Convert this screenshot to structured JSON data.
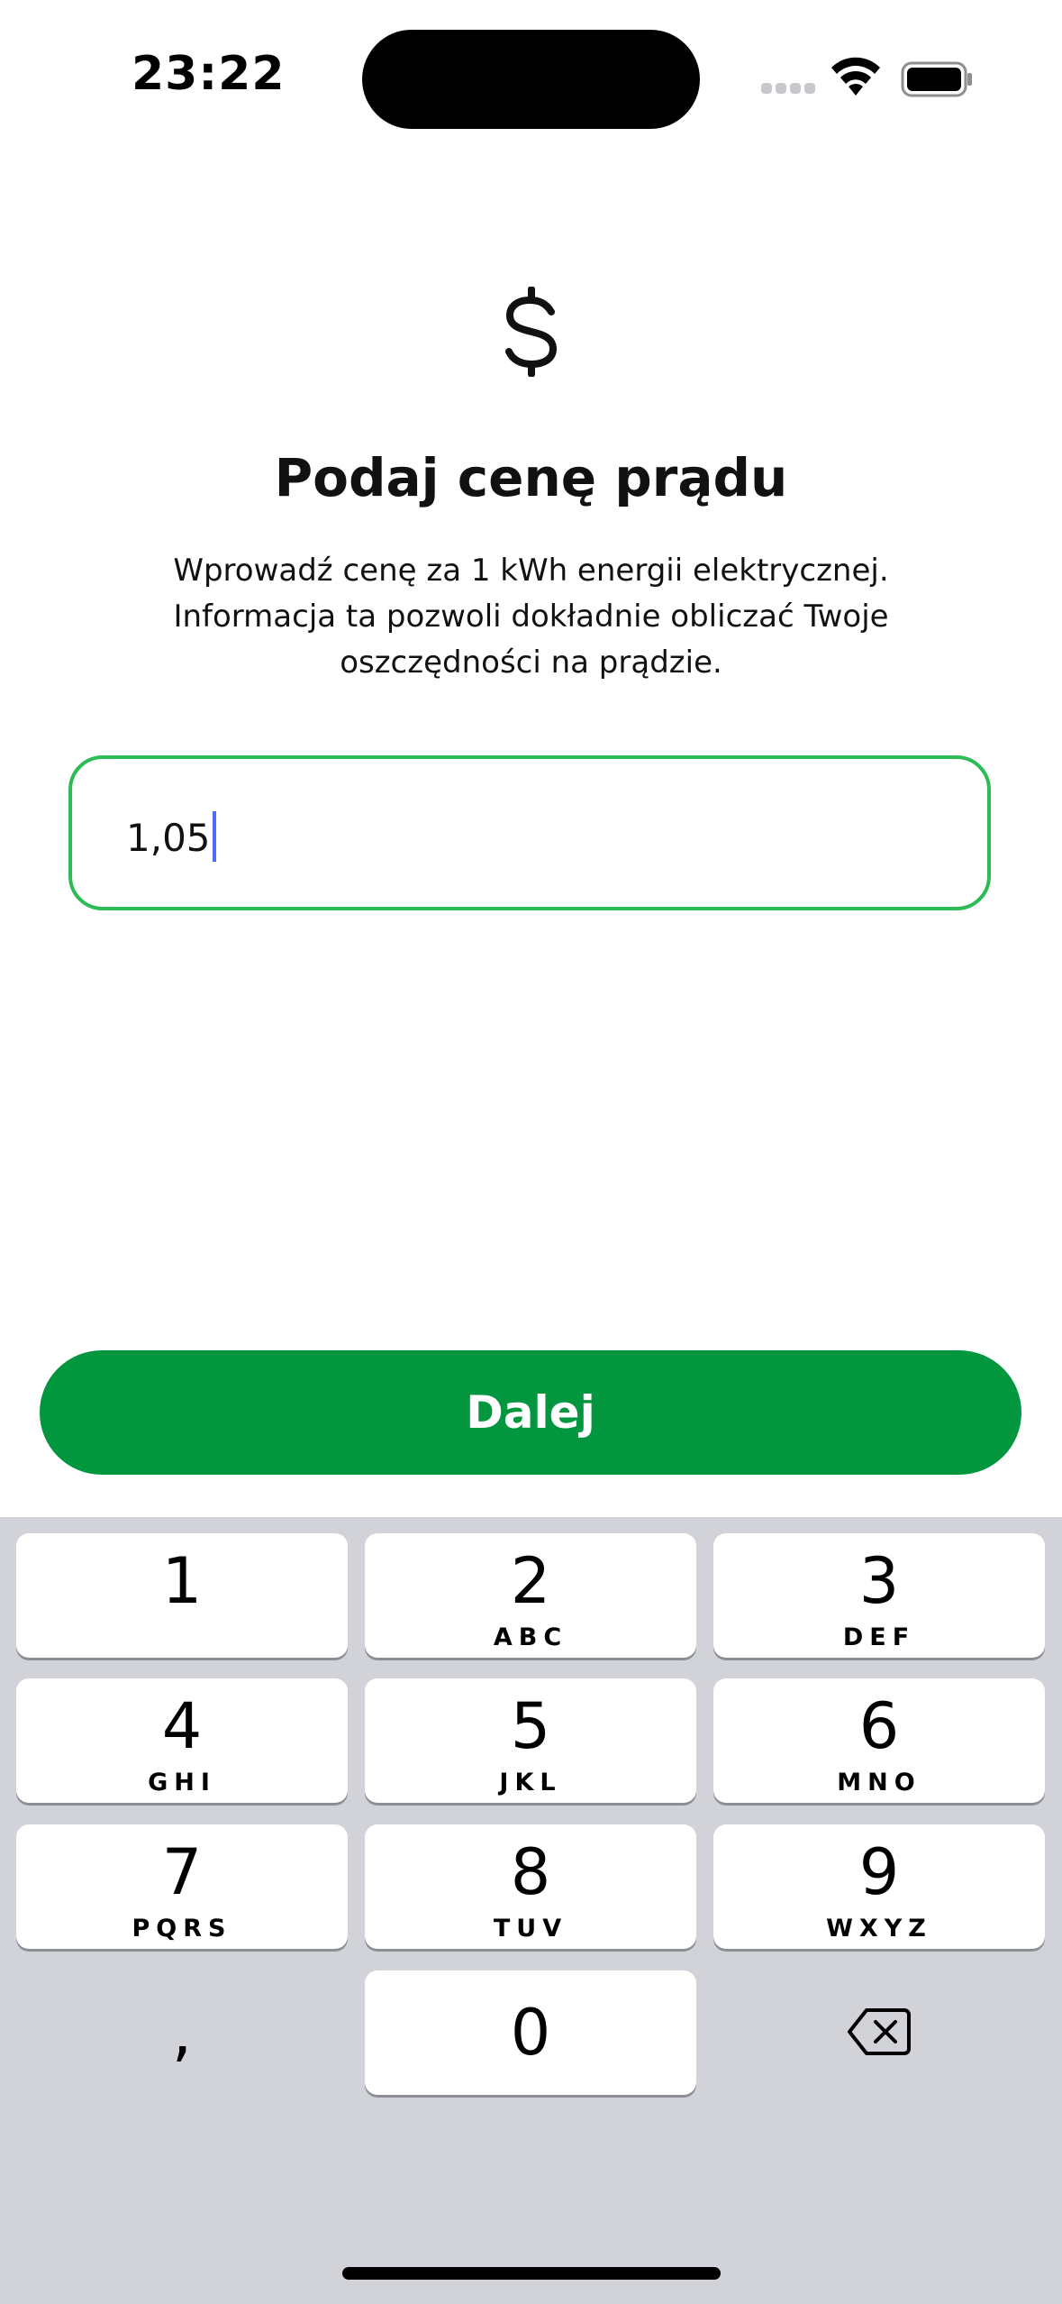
{
  "status_bar": {
    "time": "23:22"
  },
  "screen": {
    "icon": "dollar-icon",
    "title": "Podaj cenę prądu",
    "description_lines": [
      "Wprowadź cenę za 1 kWh energii elektrycznej.",
      "Informacja ta pozwoli dokładnie obliczać Twoje",
      "oszczędności na prądzie."
    ],
    "price_input": {
      "value": "1,05"
    },
    "next_button": {
      "label": "Dalej"
    }
  },
  "keyboard": {
    "keys": [
      {
        "number": "1",
        "letters": ""
      },
      {
        "number": "2",
        "letters": "ABC"
      },
      {
        "number": "3",
        "letters": "DEF"
      },
      {
        "number": "4",
        "letters": "GHI"
      },
      {
        "number": "5",
        "letters": "JKL"
      },
      {
        "number": "6",
        "letters": "MNO"
      },
      {
        "number": "7",
        "letters": "PQRS"
      },
      {
        "number": "8",
        "letters": "TUV"
      },
      {
        "number": "9",
        "letters": "WXYZ"
      },
      {
        "number": "0",
        "letters": ""
      }
    ],
    "comma_key": ",",
    "backspace_icon": "backspace-icon"
  },
  "colors": {
    "accent_green": "#02963e",
    "field_border": "#2dbb55",
    "keyboard_bg": "#d1d3d9"
  }
}
